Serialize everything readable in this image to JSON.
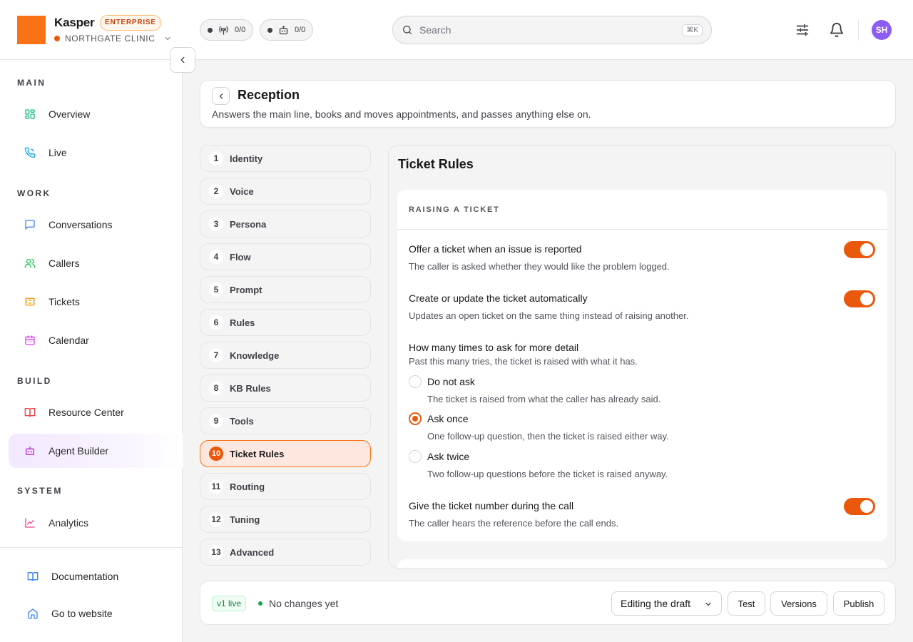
{
  "header": {
    "brand": "Kasper",
    "edition_badge": "ENTERPRISE",
    "org_name": "NORTHGATE CLINIC",
    "pills": [
      {
        "icon": "broadcast-icon",
        "count": "0/0"
      },
      {
        "icon": "robot-icon",
        "count": "0/0"
      }
    ],
    "search": {
      "placeholder": "Search",
      "shortcut": "⌘K"
    },
    "avatar_initials": "SH"
  },
  "sidebar": {
    "sections": [
      {
        "label": "MAIN",
        "items": [
          {
            "label": "Overview",
            "icon": "grid-icon"
          },
          {
            "label": "Live",
            "icon": "phone-icon"
          }
        ]
      },
      {
        "label": "WORK",
        "items": [
          {
            "label": "Conversations",
            "icon": "chat-icon"
          },
          {
            "label": "Callers",
            "icon": "users-icon"
          },
          {
            "label": "Tickets",
            "icon": "ticket-icon"
          },
          {
            "label": "Calendar",
            "icon": "calendar-icon"
          }
        ]
      },
      {
        "label": "BUILD",
        "items": [
          {
            "label": "Resource Center",
            "icon": "book-icon"
          },
          {
            "label": "Agent Builder",
            "icon": "robot-icon",
            "active": true
          }
        ]
      },
      {
        "label": "SYSTEM",
        "items": [
          {
            "label": "Analytics",
            "icon": "chart-icon"
          }
        ]
      }
    ],
    "footer_links": [
      {
        "label": "Documentation",
        "icon": "book-open-icon"
      },
      {
        "label": "Go to website",
        "icon": "home-icon"
      }
    ]
  },
  "agent": {
    "name": "Reception",
    "description": "Answers the main line, books and moves appointments, and passes anything else on."
  },
  "steps": [
    {
      "num": "1",
      "label": "Identity"
    },
    {
      "num": "2",
      "label": "Voice"
    },
    {
      "num": "3",
      "label": "Persona"
    },
    {
      "num": "4",
      "label": "Flow"
    },
    {
      "num": "5",
      "label": "Prompt"
    },
    {
      "num": "6",
      "label": "Rules"
    },
    {
      "num": "7",
      "label": "Knowledge"
    },
    {
      "num": "8",
      "label": "KB Rules"
    },
    {
      "num": "9",
      "label": "Tools"
    },
    {
      "num": "10",
      "label": "Ticket Rules",
      "active": true
    },
    {
      "num": "11",
      "label": "Routing"
    },
    {
      "num": "12",
      "label": "Tuning"
    },
    {
      "num": "13",
      "label": "Advanced"
    }
  ],
  "panel": {
    "title": "Ticket Rules",
    "section_heading": "RAISING A TICKET",
    "rules": {
      "offer": {
        "title": "Offer a ticket when an issue is reported",
        "desc": "The caller is asked whether they would like the problem logged.",
        "enabled": true
      },
      "auto": {
        "title": "Create or update the ticket automatically",
        "desc": "Updates an open ticket on the same thing instead of raising another.",
        "enabled": true
      },
      "ask": {
        "title": "How many times to ask for more detail",
        "desc": "Past this many tries, the ticket is raised with what it has.",
        "selected": "Ask once",
        "options": [
          {
            "label": "Do not ask",
            "desc": "The ticket is raised from what the caller has already said."
          },
          {
            "label": "Ask once",
            "desc": "One follow-up question, then the ticket is raised either way."
          },
          {
            "label": "Ask twice",
            "desc": "Two follow-up questions before the ticket is raised anyway."
          }
        ]
      },
      "number": {
        "title": "Give the ticket number during the call",
        "desc": "The caller hears the reference before the call ends.",
        "enabled": true
      }
    }
  },
  "footer": {
    "version_badge": "v1 live",
    "status": "No changes yet",
    "mode_select": "Editing the draft",
    "test_label": "Test",
    "versions_label": "Versions",
    "publish_label": "Publish"
  },
  "colors": {
    "accent": "#ea580c",
    "brand_square": "#f97316",
    "active_nav": "#f3e8ff",
    "avatar": "#8b5cf6",
    "live_green": "#16a34a"
  }
}
